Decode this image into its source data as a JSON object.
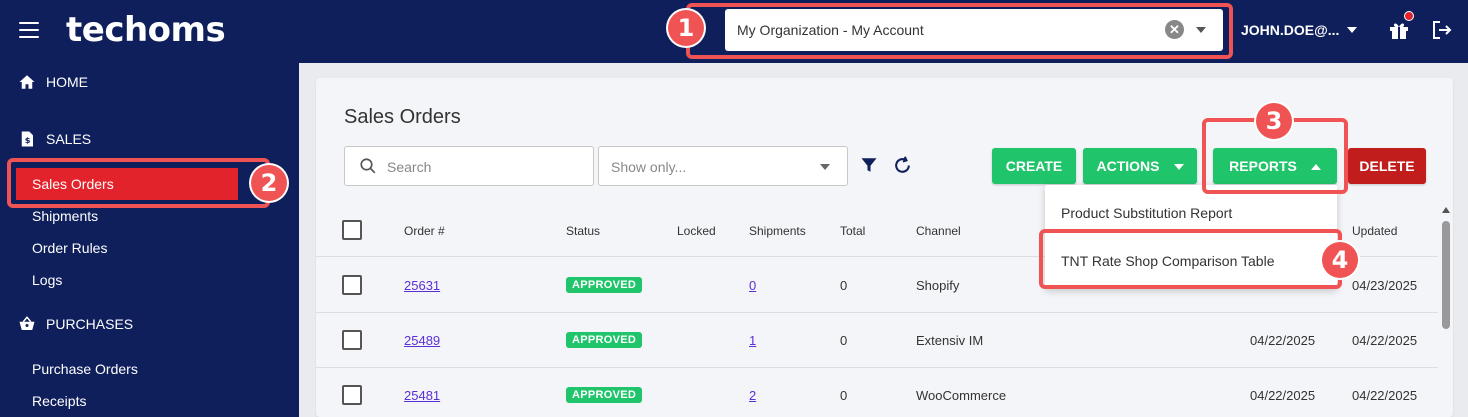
{
  "header": {
    "logo": "techoms",
    "org_select_value": "My Organization - My Account",
    "clear_symbol": "✕",
    "user": "JOHN.DOE@..."
  },
  "sidebar": {
    "home": "HOME",
    "sales": "SALES",
    "sales_items": [
      "Sales Orders",
      "Shipments",
      "Order Rules",
      "Logs"
    ],
    "purchases": "PURCHASES",
    "purchase_items": [
      "Purchase Orders",
      "Receipts"
    ]
  },
  "main": {
    "title": "Sales Orders",
    "search_placeholder": "Search",
    "show_only_placeholder": "Show only...",
    "buttons": {
      "create": "CREATE",
      "actions": "ACTIONS",
      "reports": "REPORTS",
      "delete": "DELETE"
    },
    "reports_menu": [
      "Product Substitution Report",
      "TNT Rate Shop Comparison Table"
    ],
    "columns": [
      "Order #",
      "Status",
      "Locked",
      "Shipments",
      "Total",
      "Channel",
      "Updated"
    ],
    "rows": [
      {
        "order": "25631",
        "status": "APPROVED",
        "shipments": "0",
        "total": "0",
        "channel": "Shopify",
        "date1": "",
        "updated": "04/23/2025"
      },
      {
        "order": "25489",
        "status": "APPROVED",
        "shipments": "1",
        "total": "0",
        "channel": "Extensiv IM",
        "date1": "04/22/2025",
        "updated": "04/22/2025"
      },
      {
        "order": "25481",
        "status": "APPROVED",
        "shipments": "2",
        "total": "0",
        "channel": "WooCommerce",
        "date1": "04/22/2025",
        "updated": "04/22/2025"
      }
    ]
  },
  "annotations": [
    "1",
    "2",
    "3",
    "4"
  ],
  "colors": {
    "navy": "#0e1f5b",
    "green": "#20c46b",
    "red": "#c11d1d",
    "annotation": "#f05353",
    "active_item": "#e3232b"
  }
}
